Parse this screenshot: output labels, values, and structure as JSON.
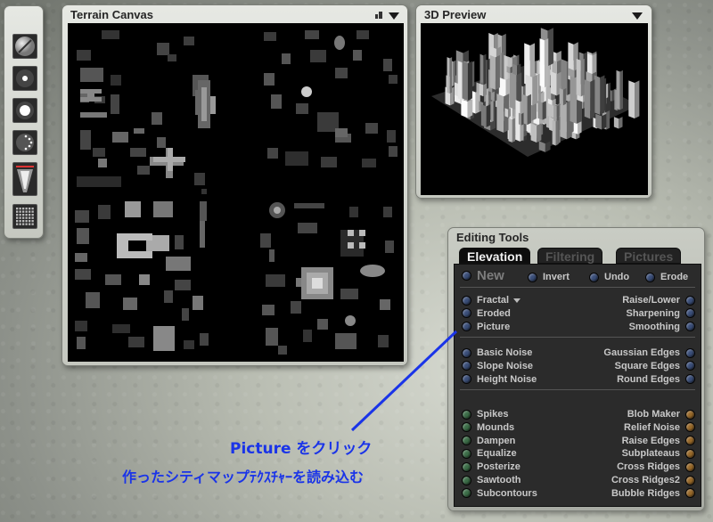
{
  "panels": {
    "terrain_canvas": {
      "title": "Terrain Canvas"
    },
    "preview": {
      "title": "3D Preview"
    },
    "editing_tools": {
      "title": "Editing Tools"
    }
  },
  "toolstrip": {
    "tools": [
      {
        "icon": "large-brush-icon"
      },
      {
        "icon": "small-dot-brush-icon"
      },
      {
        "icon": "medium-dot-brush-icon"
      },
      {
        "icon": "dotted-brush-icon"
      },
      {
        "icon": "falloff-brush-icon"
      },
      {
        "icon": "grid-pattern-icon"
      }
    ]
  },
  "editing_tools": {
    "tabs": [
      {
        "label": "Elevation",
        "active": true
      },
      {
        "label": "Filtering",
        "active": false
      },
      {
        "label": "Pictures",
        "active": false
      }
    ],
    "top_row": {
      "new": "New",
      "invert": "Invert",
      "undo": "Undo",
      "erode": "Erode"
    },
    "group1_left": [
      "Fractal",
      "Eroded",
      "Picture"
    ],
    "group1_right": [
      "Raise/Lower",
      "Sharpening",
      "Smoothing"
    ],
    "group2_left": [
      "Basic Noise",
      "Slope Noise",
      "Height Noise"
    ],
    "group2_right": [
      "Gaussian Edges",
      "Square Edges",
      "Round Edges"
    ],
    "group3_left": [
      "Spikes",
      "Mounds",
      "Dampen",
      "Equalize",
      "Posterize",
      "Sawtooth",
      "Subcontours"
    ],
    "group3_right": [
      "Blob Maker",
      "Relief Noise",
      "Raise Edges",
      "Subplateaus",
      "Cross Ridges",
      "Cross Ridges2",
      "Bubble Ridges"
    ]
  },
  "colors": {
    "knob_blue": "#3b4f7a",
    "knob_green": "#3c6e48",
    "knob_orange": "#9a6a2a",
    "annotation": "#1a34e8"
  },
  "annotation": {
    "line1": "Picture をクリック",
    "line2": "作ったシティマップﾃｸｽﾁｬｰを読み込む"
  }
}
